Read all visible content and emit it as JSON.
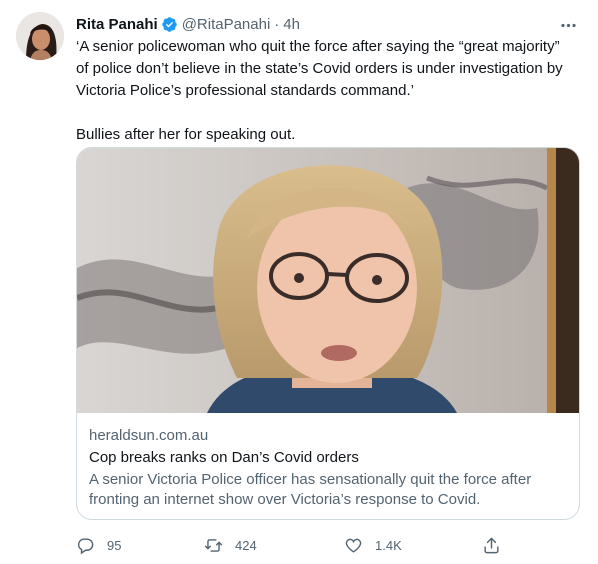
{
  "tweet": {
    "author_name": "Rita Panahi",
    "handle": "@RitaPanahi",
    "separator": "·",
    "timestamp": "4h",
    "text_paragraph_1": "‘A senior policewoman who quit the force after saying the “great majority” of police don’t believe in the state’s Covid orders is under investigation by Victoria Police’s professional standards command.’",
    "text_paragraph_2": "Bullies after her for speaking out."
  },
  "card": {
    "domain": "heraldsun.com.au",
    "title": "Cop breaks ranks on Dan’s Covid orders",
    "description": "A senior Victoria Police officer has sensationally quit the force after fronting an internet show over Victoria’s response to Covid."
  },
  "actions": {
    "reply_count": "95",
    "retweet_count": "424",
    "like_count": "1.4K"
  },
  "colors": {
    "text_primary": "#0f1419",
    "text_secondary": "#536471",
    "verified_blue": "#1d9bf0",
    "card_border": "#cfd9de"
  },
  "icons": [
    "verified-badge-icon",
    "more-icon",
    "reply-icon",
    "retweet-icon",
    "like-icon",
    "share-icon"
  ]
}
